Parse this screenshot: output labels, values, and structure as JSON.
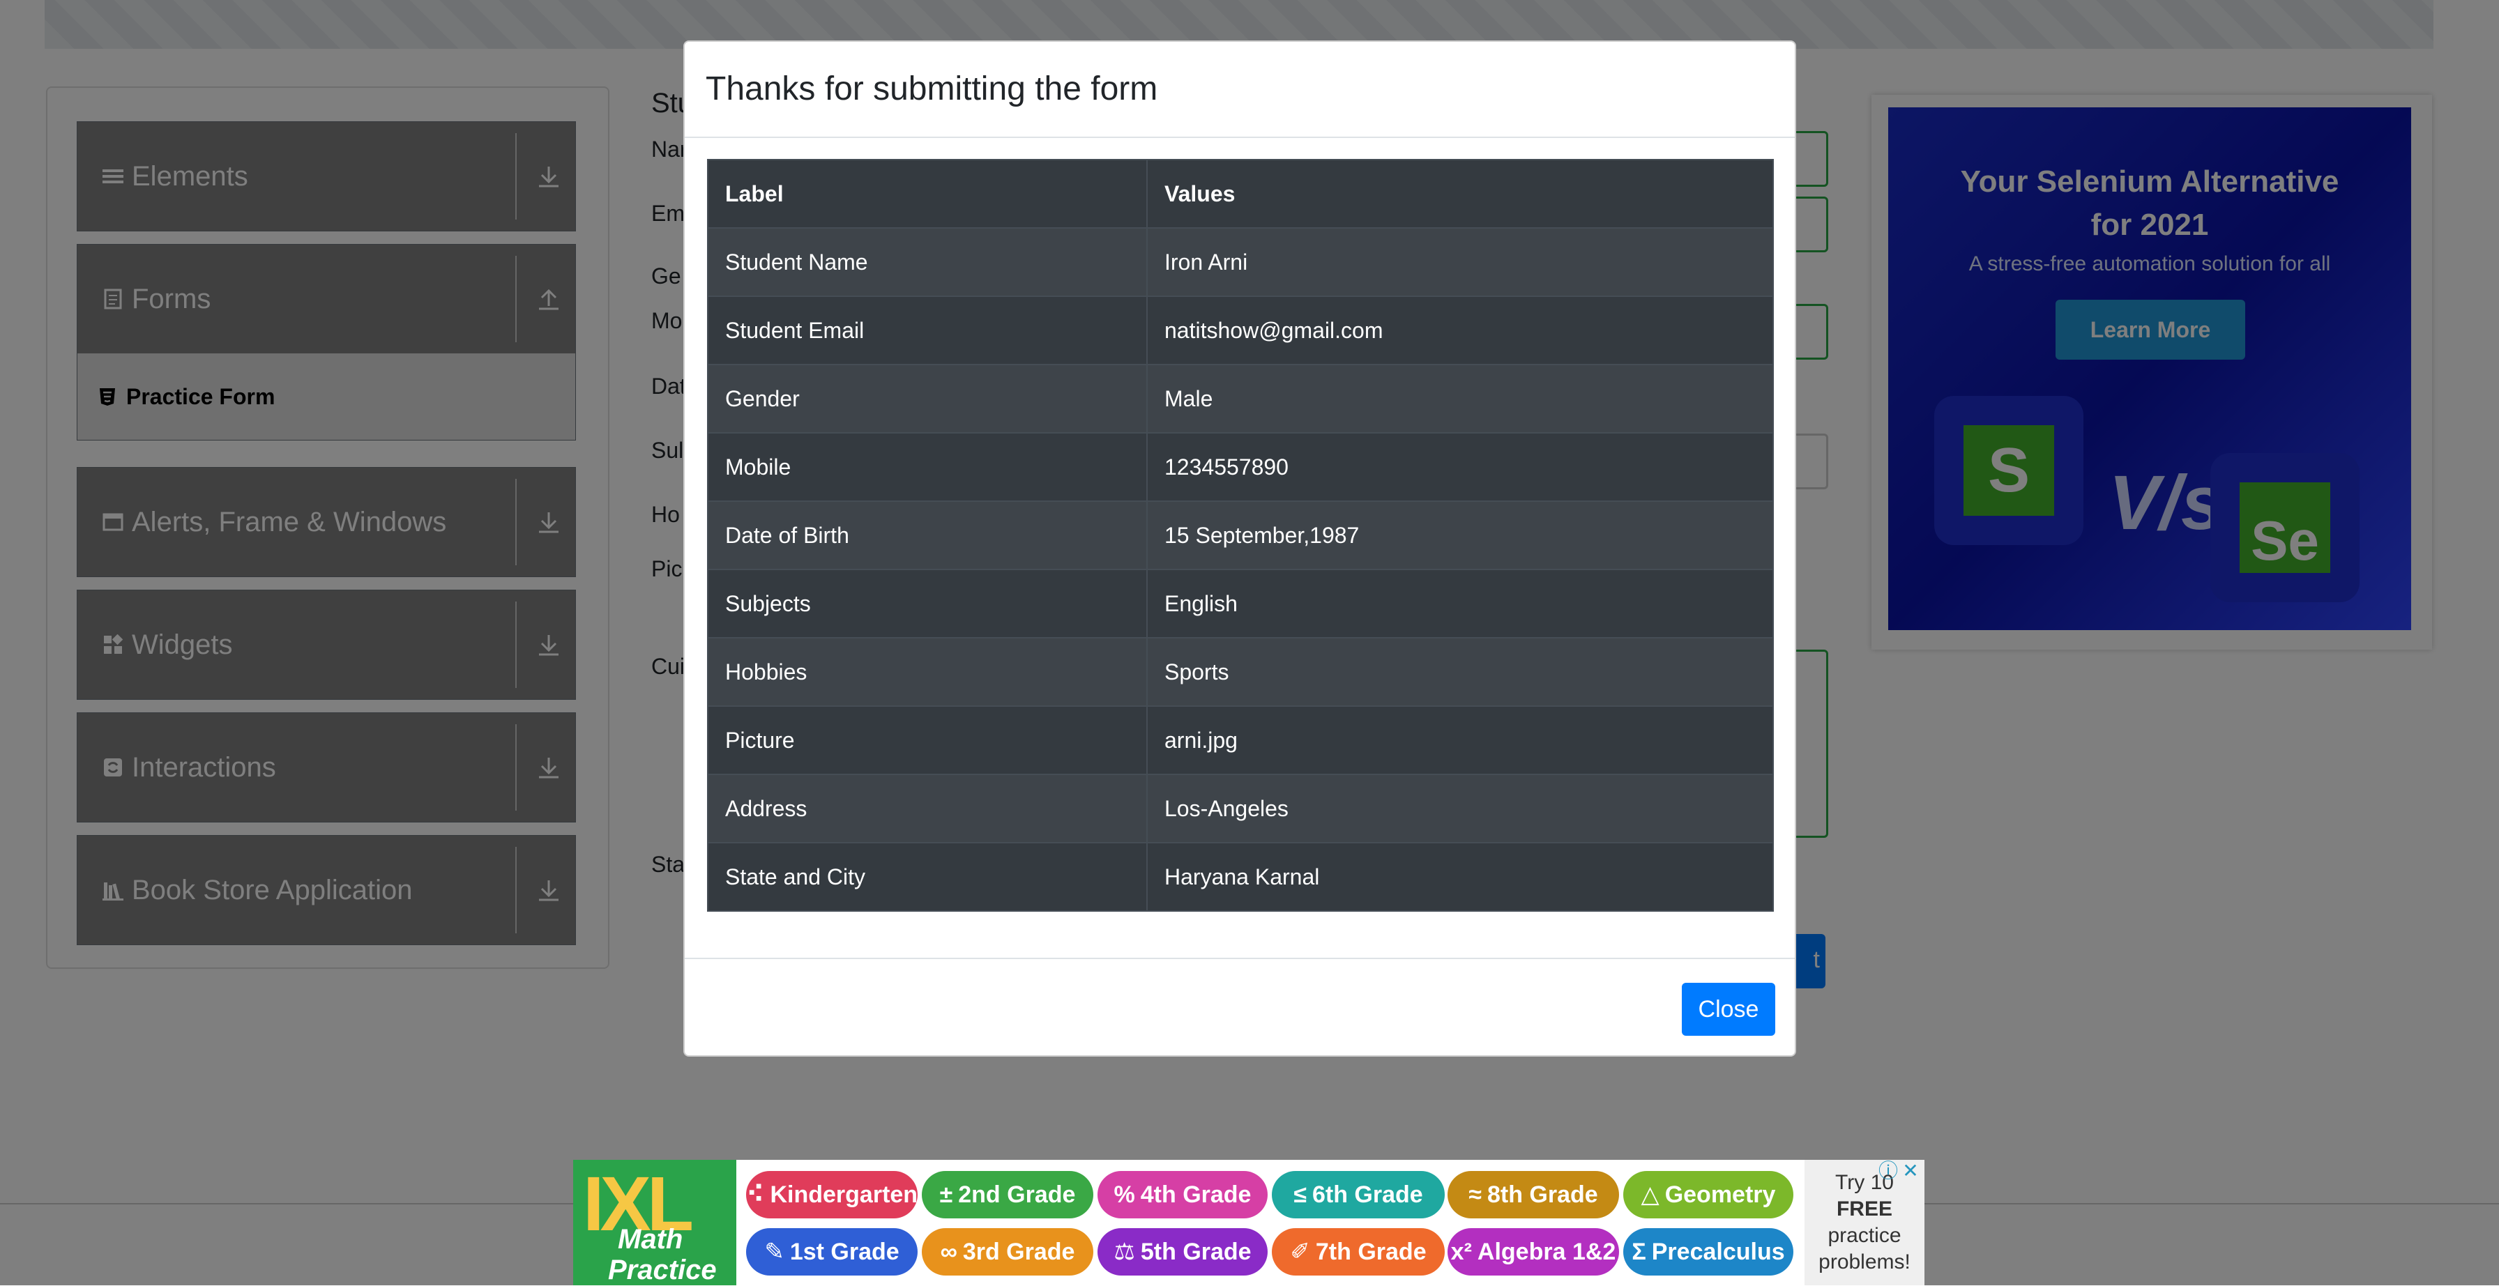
{
  "sidebar": {
    "groups": [
      {
        "label": "Elements",
        "icon": "list-icon",
        "arrow": "download-icon"
      },
      {
        "label": "Forms",
        "icon": "document-icon",
        "arrow": "upload-icon"
      },
      {
        "label": "Alerts, Frame & Windows",
        "icon": "window-icon",
        "arrow": "download-icon"
      },
      {
        "label": "Widgets",
        "icon": "widgets-icon",
        "arrow": "download-icon"
      },
      {
        "label": "Interactions",
        "icon": "interactions-icon",
        "arrow": "download-icon"
      },
      {
        "label": "Book Store Application",
        "icon": "books-icon",
        "arrow": "download-icon"
      }
    ],
    "forms_items": [
      {
        "label": "Practice Form",
        "icon": "html5-icon"
      }
    ]
  },
  "background_form": {
    "labels": [
      "Stu",
      "Nar",
      "Em",
      "Ge",
      "Mo",
      "Dat",
      "Sul",
      "Ho",
      "Pic",
      "Cui",
      "Sta"
    ],
    "submit_fragment": "t"
  },
  "ad_right": {
    "title_line1": "Your Selenium Alternative",
    "title_line2": "for 2021",
    "subtitle": "A stress-free automation solution for all",
    "button": "Learn More",
    "vs": "V/s",
    "logo_left": "S",
    "logo_right": "Se"
  },
  "modal": {
    "title": "Thanks for submitting the form",
    "headers": [
      "Label",
      "Values"
    ],
    "rows": [
      {
        "label": "Student Name",
        "value": "Iron Arni"
      },
      {
        "label": "Student Email",
        "value": "natitshow@gmail.com"
      },
      {
        "label": "Gender",
        "value": "Male"
      },
      {
        "label": "Mobile",
        "value": "1234557890"
      },
      {
        "label": "Date of Birth",
        "value": "15 September,1987"
      },
      {
        "label": "Subjects",
        "value": "English"
      },
      {
        "label": "Hobbies",
        "value": "Sports"
      },
      {
        "label": "Picture",
        "value": "arni.jpg"
      },
      {
        "label": "Address",
        "value": "Los-Angeles"
      },
      {
        "label": "State and City",
        "value": "Haryana Karnal"
      }
    ],
    "close_label": "Close"
  },
  "ixl_ad": {
    "logo": "IXL",
    "logo_line1": "Math",
    "logo_line2": "Practice",
    "pills_row1": [
      {
        "label": "Kindergarten",
        "icon": "⠪",
        "color": "#e03c5a"
      },
      {
        "label": "2nd Grade",
        "icon": "±",
        "color": "#3aa845"
      },
      {
        "label": "4th Grade",
        "icon": "%",
        "color": "#d63fa5"
      },
      {
        "label": "6th Grade",
        "icon": "≤",
        "color": "#1fa8a0"
      },
      {
        "label": "8th Grade",
        "icon": "≈",
        "color": "#c48a14"
      },
      {
        "label": "Geometry",
        "icon": "△",
        "color": "#7cb82a"
      }
    ],
    "pills_row2": [
      {
        "label": "1st Grade",
        "icon": "✎",
        "color": "#2f5fd6"
      },
      {
        "label": "3rd Grade",
        "icon": "∞",
        "color": "#e8921c"
      },
      {
        "label": "5th Grade",
        "icon": "⚖",
        "color": "#8a2bc7"
      },
      {
        "label": "7th Grade",
        "icon": "✐",
        "color": "#ef6a2c"
      },
      {
        "label": "Algebra 1&2",
        "icon": "x²",
        "color": "#b32fc0"
      },
      {
        "label": "Precalculus",
        "icon": "Σ",
        "color": "#1d86c8"
      }
    ],
    "side_text": [
      "Try 10",
      "FREE",
      "practice",
      "problems!"
    ]
  }
}
